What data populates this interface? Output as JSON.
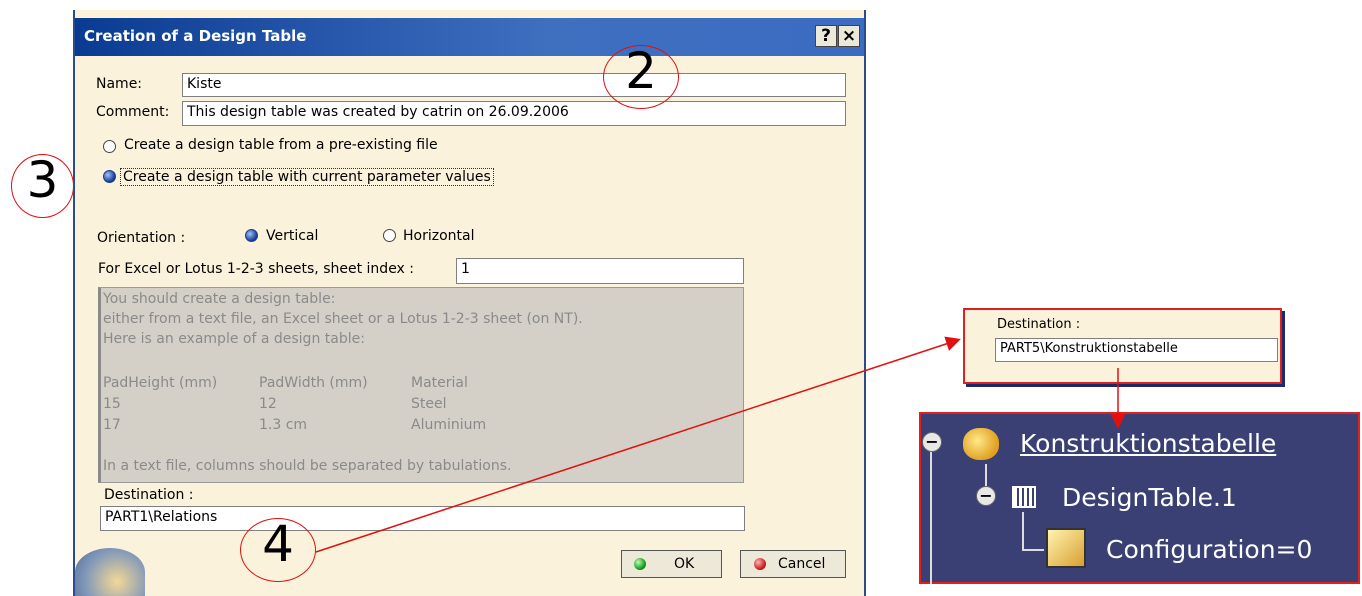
{
  "dialog": {
    "title": "Creation of a Design Table",
    "help_label": "?",
    "close_label": "×",
    "name_label": "Name:",
    "name_value": "Kiste",
    "comment_label": "Comment:",
    "comment_value": "This design table was created by catrin on 26.09.2006",
    "option_file": "Create a design table from a pre-existing file",
    "option_current": "Create a design table with current parameter values",
    "orientation_label": "Orientation :",
    "orientation_vertical": "Vertical",
    "orientation_horizontal": "Horizontal",
    "sheet_index_label": "For Excel or Lotus 1-2-3 sheets, sheet index :",
    "sheet_index_value": "1",
    "example_lines": [
      "You should create a design table:",
      "either from a text file, an Excel sheet or a Lotus 1-2-3 sheet (on NT).",
      "Here is an example of a design table:"
    ],
    "example_table": {
      "headers": [
        "PadHeight (mm)",
        "PadWidth (mm)",
        "Material"
      ],
      "rows": [
        [
          "15",
          "12",
          "Steel"
        ],
        [
          "17",
          "1.3 cm",
          "Aluminium"
        ]
      ]
    },
    "example_footer": "In a text file, columns should be separated by tabulations.",
    "destination_label": "Destination :",
    "destination_value": "PART1\\Relations",
    "ok_label": "OK",
    "cancel_label": "Cancel"
  },
  "annotations": {
    "step2": "2",
    "step3": "3",
    "step4": "4"
  },
  "destination_zoom": {
    "label": "Destination :",
    "value": "PART5\\Konstruktionstabelle"
  },
  "tree": {
    "root": "Konstruktionstabelle",
    "child": "DesignTable.1",
    "grandchild": "Configuration=0"
  },
  "colors": {
    "annotation_red": "#e01010",
    "title_blue": "#0a3b92",
    "tree_bg": "#3a3f74"
  }
}
